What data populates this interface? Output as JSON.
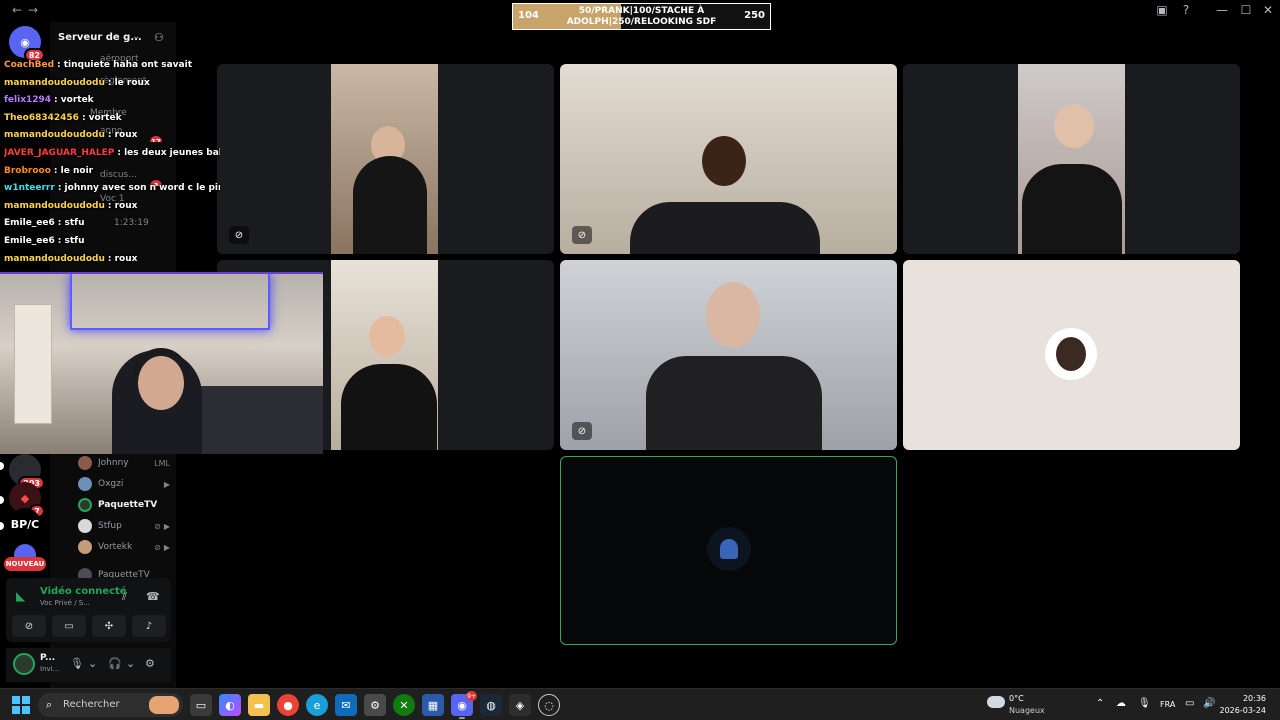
{
  "titlebar": {
    "back": "←",
    "forward": "→",
    "minimize": "—",
    "maximize": "☐",
    "close": "✕"
  },
  "counter": {
    "min": "104",
    "max": "250",
    "progress": 0.42,
    "line1": "50/PRANK|100/STACHE À",
    "line2": "ADOLPH|250/RELOOKING SDF"
  },
  "rail": {
    "home_badge": "82",
    "items": [
      {
        "badge": "203"
      },
      {
        "badge": "7"
      },
      {
        "label": "BP/C"
      }
    ],
    "new_label": "NOUVEAU"
  },
  "sidebar": {
    "server_name": "Serveur de g...",
    "channels": [
      {
        "label": "aéroport"
      },
      {
        "label": "règlement"
      },
      {
        "label": "Membre"
      },
      {
        "label": "anno...",
        "badge": "17"
      },
      {
        "label": "discus...",
        "badge": "3"
      },
      {
        "label": "Voc 1"
      }
    ],
    "voice_timer": "1:23:19",
    "members": [
      {
        "name": "Johnny",
        "extra": "LML"
      },
      {
        "name": "Oxgzi"
      },
      {
        "name": "PaquetteTV"
      },
      {
        "name": "Stfup"
      },
      {
        "name": "Vortekk"
      },
      {
        "name": "PaquetteTV"
      }
    ]
  },
  "voice_panel": {
    "title": "Vidéo connecté",
    "subtitle": "Voc Privé / S..."
  },
  "user_panel": {
    "name": "P...",
    "status": "Invi..."
  },
  "chat": [
    {
      "user": "CoachBed",
      "msg": "tinquiete haha ont savait",
      "color": "#ff9a3d"
    },
    {
      "user": "mamandoudoudodu",
      "msg": "le roux",
      "color": "#ffd24a"
    },
    {
      "user": "felix1294",
      "msg": "vortek",
      "color": "#b77cff"
    },
    {
      "user": "Theo68342456",
      "msg": "vortek",
      "color": "#ffd24a"
    },
    {
      "user": "mamandoudoudodu",
      "msg": "roux",
      "color": "#ffd24a"
    },
    {
      "user": "JAVER_JAGUAR_HALEP",
      "msg": "les deux jeunes bakas",
      "color": "#ff3b3b"
    },
    {
      "user": "Brobrooo",
      "msg": "le noir",
      "color": "#ff8a1e"
    },
    {
      "user": "w1nteerrr",
      "msg": "johnny avec son n word c le pire",
      "color": "#3be0e8"
    },
    {
      "user": "mamandoudoudodu",
      "msg": "roux",
      "color": "#ffd24a"
    },
    {
      "user": "Emile_ee6",
      "msg": "stfu",
      "color": "#ffffff"
    },
    {
      "user": "Emile_ee6",
      "msg": "stfu",
      "color": "#ffffff"
    },
    {
      "user": "mamandoudoudodu",
      "msg": "roux",
      "color": "#ffd24a"
    }
  ],
  "taskbar": {
    "search": "Rechercher",
    "discord_badge": "9+",
    "weather_temp": "0°C",
    "weather_desc": "Nuageux",
    "lang": "FRA",
    "time": "20:36",
    "date": "2026-03-24"
  },
  "colors": {
    "accent_green": "#23a55a",
    "badge_red": "#da373c",
    "active_tile_border": "#3ba55d"
  }
}
